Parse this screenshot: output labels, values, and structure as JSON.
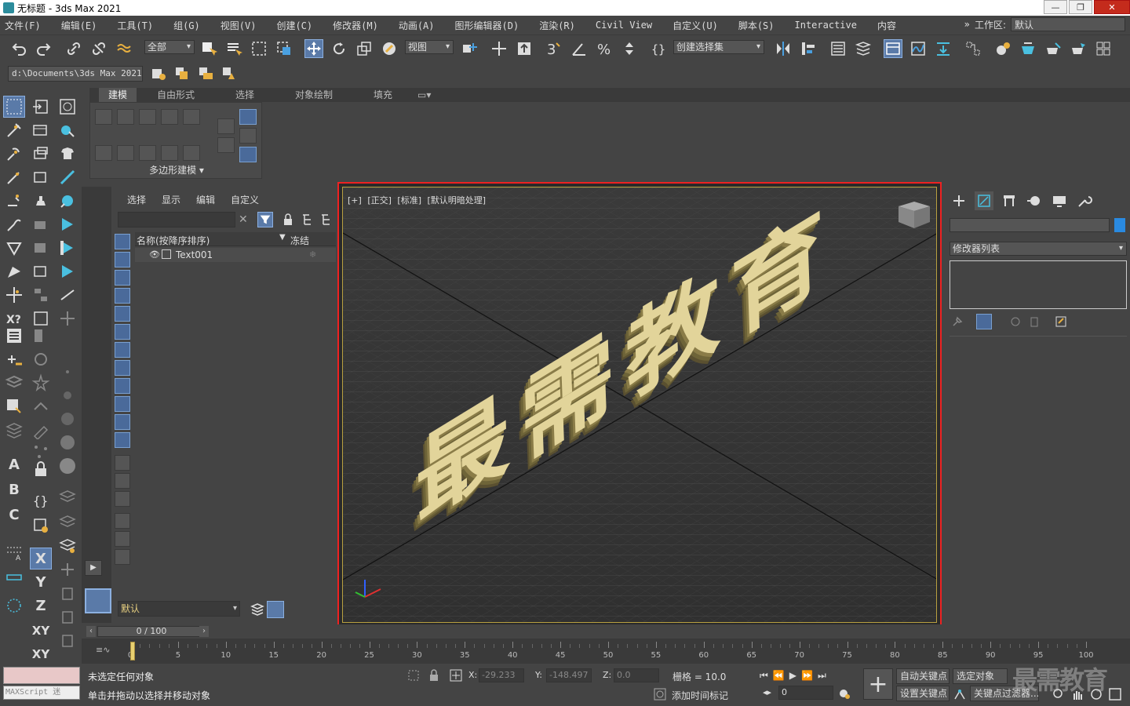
{
  "window": {
    "title": "无标题 - 3ds Max 2021",
    "minimize": "—",
    "restore": "❐",
    "close": "✕"
  },
  "menu": [
    "文件(F)",
    "编辑(E)",
    "工具(T)",
    "组(G)",
    "视图(V)",
    "创建(C)",
    "修改器(M)",
    "动画(A)",
    "图形编辑器(D)",
    "渲染(R)",
    "Civil View",
    "自定义(U)",
    "脚本(S)",
    "Interactive",
    "内容"
  ],
  "workspace": {
    "label": "工作区:",
    "value": "默认",
    "chevron": "»"
  },
  "toolbar": {
    "selection_filter": "全部",
    "ref_coord": "视图",
    "named_selection": "创建选择集"
  },
  "project_path": "d:\\Documents\\3ds Max 2021",
  "ribbon": {
    "tabs": [
      "建模",
      "自由形式",
      "选择",
      "对象绘制",
      "填充"
    ],
    "active_tab": "建模",
    "panel_label": "多边形建模 ▾"
  },
  "left_tools": {
    "axis_x": "X",
    "axis_y": "Y",
    "axis_z": "Z",
    "axis_xy": "XY",
    "axis_xy2": "XY",
    "text_a": "A",
    "text_b": "B",
    "text_c": "C"
  },
  "scene_explorer": {
    "tabs": [
      "选择",
      "显示",
      "编辑",
      "自定义"
    ],
    "col_name": "名称(按降序排序)",
    "col_freeze": "冻结",
    "sort_icon": "▼",
    "close_icon": "✕",
    "rows": [
      {
        "name": "Text001"
      }
    ],
    "layer": "默认"
  },
  "viewport": {
    "labels": [
      "[+]",
      "[正交]",
      "[标准]",
      "[默认明暗处理]"
    ],
    "text3d": [
      "最",
      "需",
      "教",
      "育"
    ]
  },
  "command_panel": {
    "modifier_list": "修改器列表"
  },
  "timeline": {
    "slider": "0 / 100",
    "ticks": [
      0,
      5,
      10,
      15,
      20,
      25,
      30,
      35,
      40,
      45,
      50,
      55,
      60,
      65,
      70,
      75,
      80,
      85,
      90,
      95,
      100
    ]
  },
  "status": {
    "maxscript": "MAXScript 迷",
    "line1": "未选定任何对象",
    "line2": "单击并拖动以选择并移动对象",
    "x_label": "X:",
    "x_value": "-29.233",
    "y_label": "Y:",
    "y_value": "-148.497",
    "z_label": "Z:",
    "z_value": "0.0",
    "grid": "栅格 = 10.0",
    "add_time_tag": "添加时间标记",
    "auto_key": "自动关键点",
    "set_key": "设置关键点",
    "selected": "选定对象",
    "key_filters": "关键点过滤器...",
    "frame": "0"
  },
  "watermark": "最需教育",
  "colors": {
    "accent": "#5a7aa8",
    "highlight_border": "#e22222",
    "text_gold": "#d8c88a"
  }
}
